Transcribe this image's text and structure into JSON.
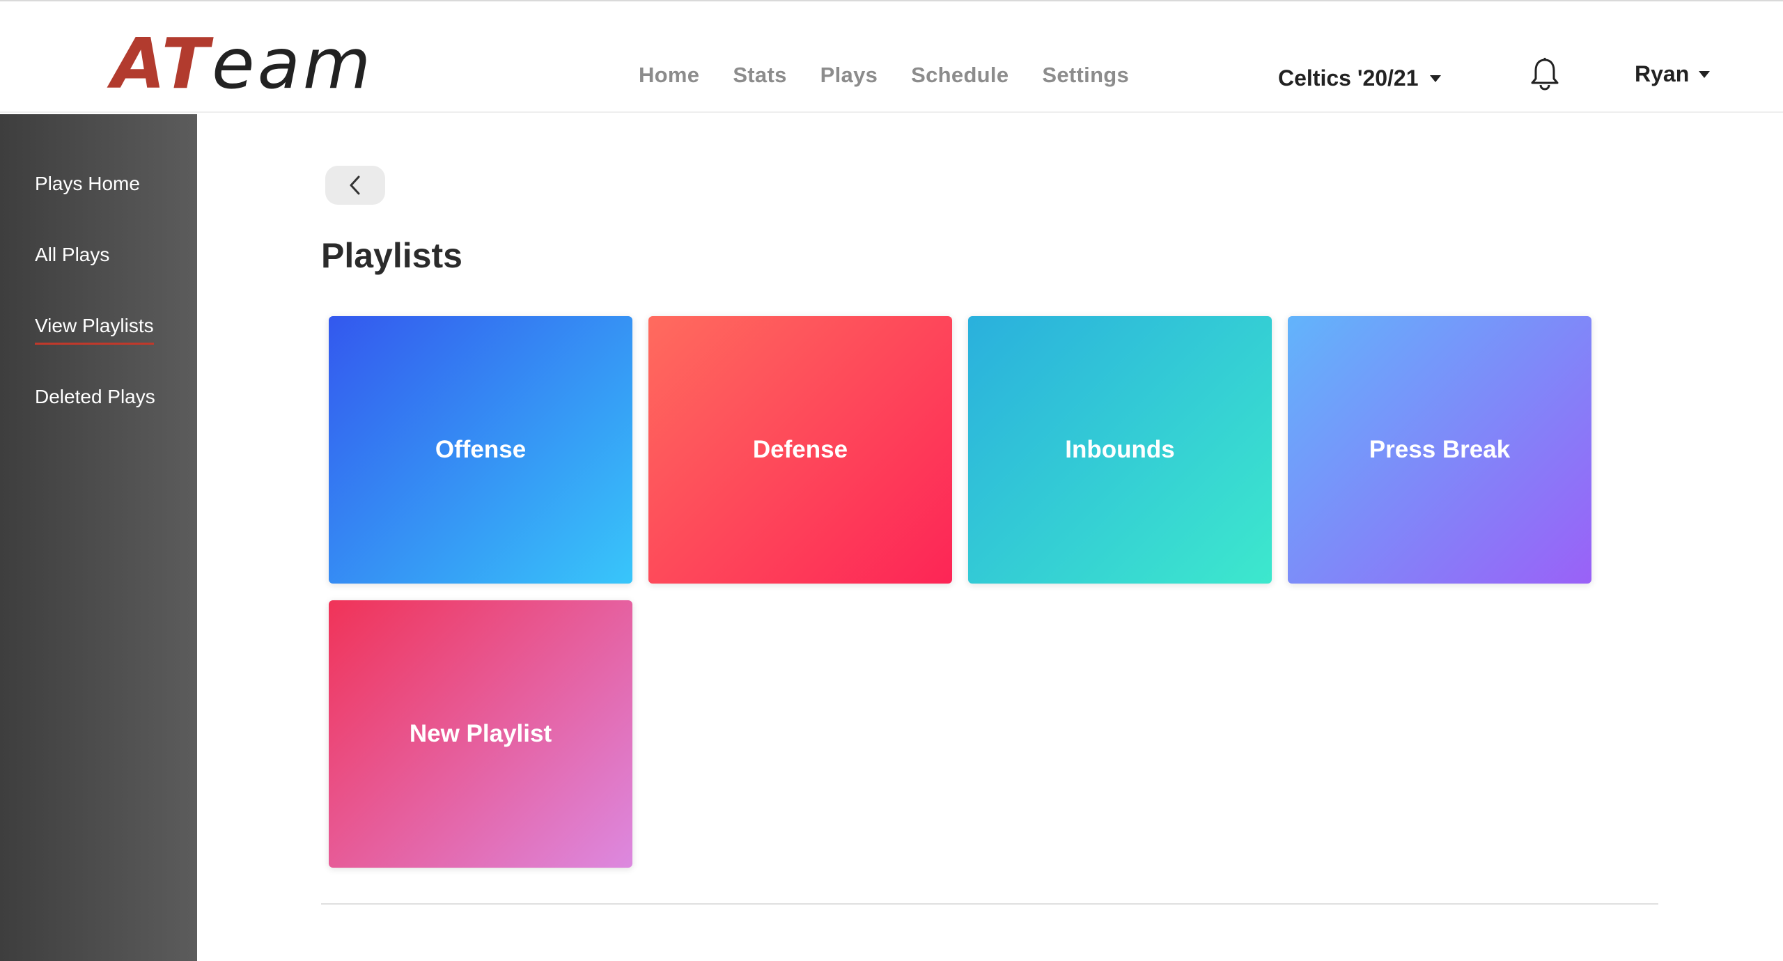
{
  "app": {
    "logo_part1": "AT",
    "logo_part2": "eam",
    "brand_color": "#b23b2e"
  },
  "nav": {
    "items": [
      {
        "label": "Home"
      },
      {
        "label": "Stats"
      },
      {
        "label": "Plays"
      },
      {
        "label": "Schedule"
      },
      {
        "label": "Settings"
      }
    ]
  },
  "team_selector": {
    "label": "Celtics '20/21"
  },
  "notifications": {
    "icon": "bell-icon"
  },
  "user_menu": {
    "label": "Ryan"
  },
  "sidebar": {
    "items": [
      {
        "label": "Plays Home",
        "active": false
      },
      {
        "label": "All Plays",
        "active": false
      },
      {
        "label": "View Playlists",
        "active": true
      },
      {
        "label": "Deleted Plays",
        "active": false
      }
    ],
    "active_underline_color": "#c0392b"
  },
  "back_button": {
    "icon": "chevron-left-icon"
  },
  "page": {
    "title": "Playlists"
  },
  "playlists": [
    {
      "label": "Offense",
      "gradient": [
        "#3358ee",
        "#38c6fa"
      ]
    },
    {
      "label": "Defense",
      "gradient": [
        "#ff6b5e",
        "#fd2556"
      ]
    },
    {
      "label": "Inbounds",
      "gradient": [
        "#2ab0dd",
        "#3de8cd"
      ]
    },
    {
      "label": "Press Break",
      "gradient": [
        "#62b4fb",
        "#9a61f7"
      ]
    },
    {
      "label": "New Playlist",
      "gradient": [
        "#f03358",
        "#dc89e0"
      ]
    }
  ]
}
